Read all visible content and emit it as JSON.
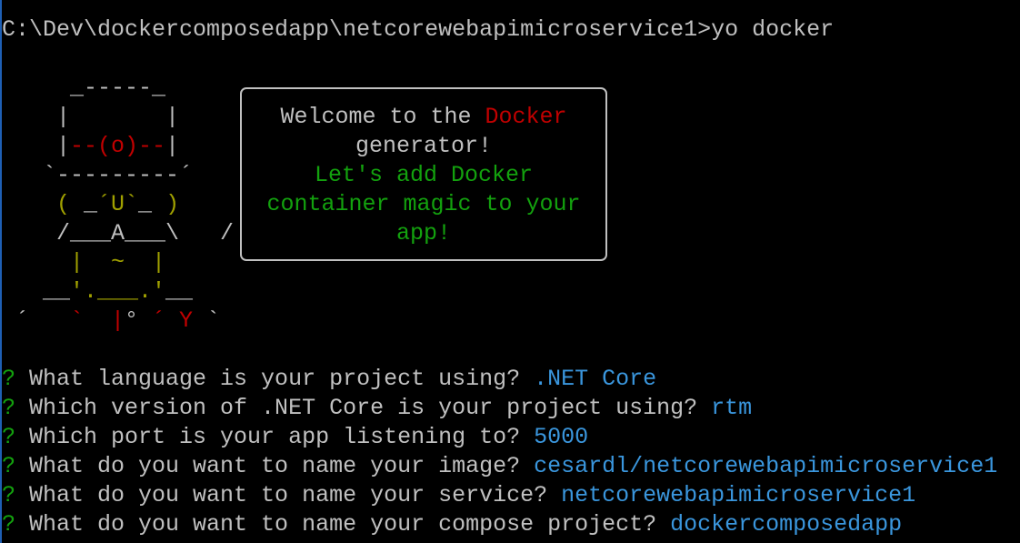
{
  "terminal": {
    "command_line": "C:\\Dev\\dockercomposedapp\\netcorewebapimicroservice1>yo docker"
  },
  "ascii_art": {
    "rows": [
      [
        {
          "t": "     _-----_     ",
          "c": "w"
        }
      ],
      [
        {
          "t": "    |       |    ",
          "c": "w"
        }
      ],
      [
        {
          "t": "    |",
          "c": "w"
        },
        {
          "t": "--(o)--",
          "c": "r"
        },
        {
          "t": "|    ",
          "c": "w"
        }
      ],
      [
        {
          "t": "   `---------´   ",
          "c": "w"
        }
      ],
      [
        {
          "t": "    ( ",
          "c": "y"
        },
        {
          "t": "_",
          "c": "w"
        },
        {
          "t": "´U`",
          "c": "y"
        },
        {
          "t": "_",
          "c": "w"
        },
        {
          "t": " )    ",
          "c": "y"
        }
      ],
      [
        {
          "t": "    /___A___\\   /",
          "c": "w"
        }
      ],
      [
        {
          "t": "     |  ~  |     ",
          "c": "y"
        }
      ],
      [
        {
          "t": "   __",
          "c": "w"
        },
        {
          "t": "'.___.'",
          "c": "y"
        },
        {
          "t": "__   ",
          "c": "w"
        }
      ],
      [
        {
          "t": " ´   ",
          "c": "w"
        },
        {
          "t": "`  |",
          "c": "r"
        },
        {
          "t": "° ",
          "c": "w"
        },
        {
          "t": "´ Y",
          "c": "r"
        },
        {
          "t": " ` ",
          "c": "w"
        }
      ]
    ]
  },
  "welcome_box": {
    "line1_prefix": "Welcome to the ",
    "line1_highlight": "Docker",
    "line2": "generator!",
    "line3": "Let's add Docker",
    "line4": "container magic to your",
    "line5": "app!"
  },
  "prompts": [
    {
      "marker": "?",
      "question": " What language is your project using? ",
      "answer": ".NET Core"
    },
    {
      "marker": "?",
      "question": " Which version of .NET Core is your project using? ",
      "answer": "rtm"
    },
    {
      "marker": "?",
      "question": " Which port is your app listening to? ",
      "answer": "5000"
    },
    {
      "marker": "?",
      "question": " What do you want to name your image? ",
      "answer": "cesardl/netcorewebapimicroservice1"
    },
    {
      "marker": "?",
      "question": " What do you want to name your service? ",
      "answer": "netcorewebapimicroservice1"
    },
    {
      "marker": "?",
      "question": " What do you want to name your compose project? ",
      "answer": "dockercomposedapp"
    }
  ],
  "colors": {
    "background": "#000000",
    "text": "#c0c0c0",
    "red": "#c00000",
    "yellow": "#a0a000",
    "green": "#13a10e",
    "cyan": "#3a96dd"
  }
}
